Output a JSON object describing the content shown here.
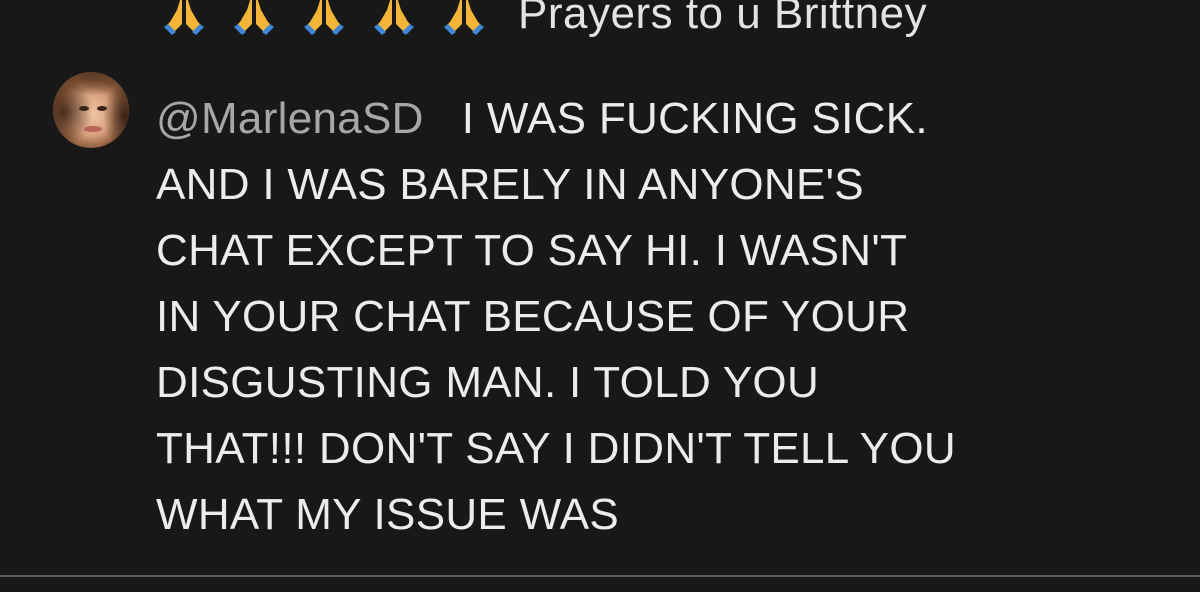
{
  "previous_comment": {
    "emoji_count": 5,
    "emoji_icon": "folded-hands-icon",
    "text": "Prayers to u Brittney"
  },
  "comment": {
    "avatar_icon": "user-avatar",
    "mention": "@MarlenaSD",
    "first_line": "I WAS FUCKING SICK.",
    "lines": [
      "AND I WAS BARELY IN ANYONE'S",
      "CHAT EXCEPT TO SAY HI. I WASN'T",
      "IN YOUR CHAT BECAUSE OF YOUR",
      "DISGUSTING MAN. I TOLD YOU",
      "THAT!!! DON'T SAY I DIDN'T TELL YOU",
      "WHAT MY ISSUE WAS"
    ]
  },
  "colors": {
    "background": "#181818",
    "text": "#ececec",
    "mention": "#a7a7a7",
    "divider": "#5a5a5a"
  }
}
